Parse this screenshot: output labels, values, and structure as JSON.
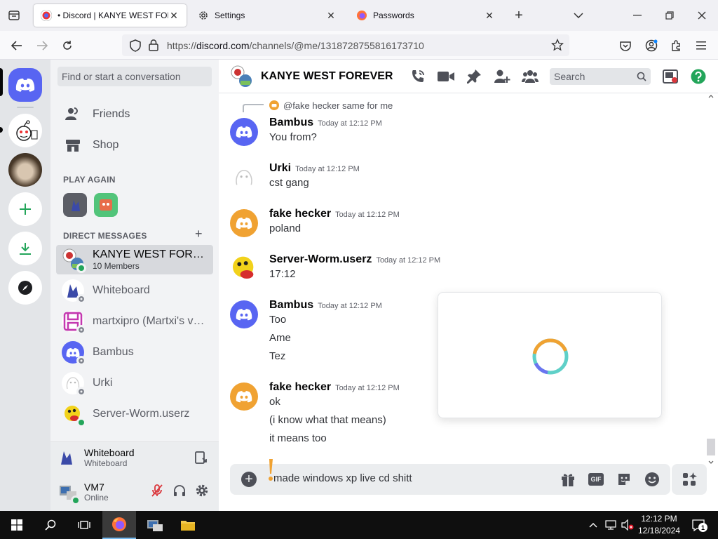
{
  "browser": {
    "tabs": [
      {
        "title": "• Discord | KANYE WEST FOREVER",
        "active": true
      },
      {
        "title": "Settings",
        "active": false
      },
      {
        "title": "Passwords",
        "active": false
      }
    ],
    "url_prefix": "https://",
    "url_host": "discord.com",
    "url_path": "/channels/@me/1318728755816173710"
  },
  "sidebar": {
    "search_placeholder": "Find or start a conversation",
    "nav": [
      {
        "label": "Friends"
      },
      {
        "label": "Shop"
      }
    ],
    "play_again_label": "PLAY AGAIN",
    "dm_label": "DIRECT MESSAGES",
    "dm_add": "+",
    "dms": [
      {
        "name": "KANYE WEST FOREVER",
        "sub": "10 Members",
        "selected": true
      },
      {
        "name": "Whiteboard",
        "status": "offline"
      },
      {
        "name": "martxipro (Martxi's verified)",
        "status": "offline"
      },
      {
        "name": "Bambus",
        "status": "offline"
      },
      {
        "name": "Urki",
        "status": "offline"
      },
      {
        "name": "Server-Worm.userz",
        "status": "online"
      }
    ],
    "activity": {
      "title": "Whiteboard",
      "sub": "Whiteboard"
    },
    "user": {
      "name": "VM7",
      "status": "Online"
    }
  },
  "chat": {
    "channel_name": "KANYE WEST FOREVER",
    "search_placeholder": "Search",
    "reply_ref": "@fake hecker same for me",
    "messages": [
      {
        "author": "Bambus",
        "time": "Today at 12:12 PM",
        "lines": [
          "You from?"
        ]
      },
      {
        "author": "Urki",
        "time": "Today at 12:12 PM",
        "lines": [
          "cst gang"
        ]
      },
      {
        "author": "fake hecker",
        "time": "Today at 12:12 PM",
        "lines": [
          "poland"
        ]
      },
      {
        "author": "Server-Worm.userz",
        "time": "Today at 12:12 PM",
        "lines": [
          "17:12"
        ]
      },
      {
        "author": "Bambus",
        "time": "Today at 12:12 PM",
        "lines": [
          "Too",
          "Ame",
          "Tez"
        ]
      },
      {
        "author": "fake hecker",
        "time": "Today at 12:12 PM",
        "lines": [
          "ok",
          "(i know what that means)",
          "it means too"
        ]
      }
    ],
    "composer_draft": "made windows xp live cd shitt",
    "gif_label": "GIF"
  },
  "colors": {
    "blurple": "#5865f2",
    "orange": "#f0a232",
    "green": "#23a55a",
    "spinner_a": "#f0a232",
    "spinner_b": "#5fd0c8",
    "spinner_c": "#6b74f0"
  },
  "taskbar": {
    "time": "12:12 PM",
    "date": "12/18/2024",
    "notifications": "1"
  }
}
